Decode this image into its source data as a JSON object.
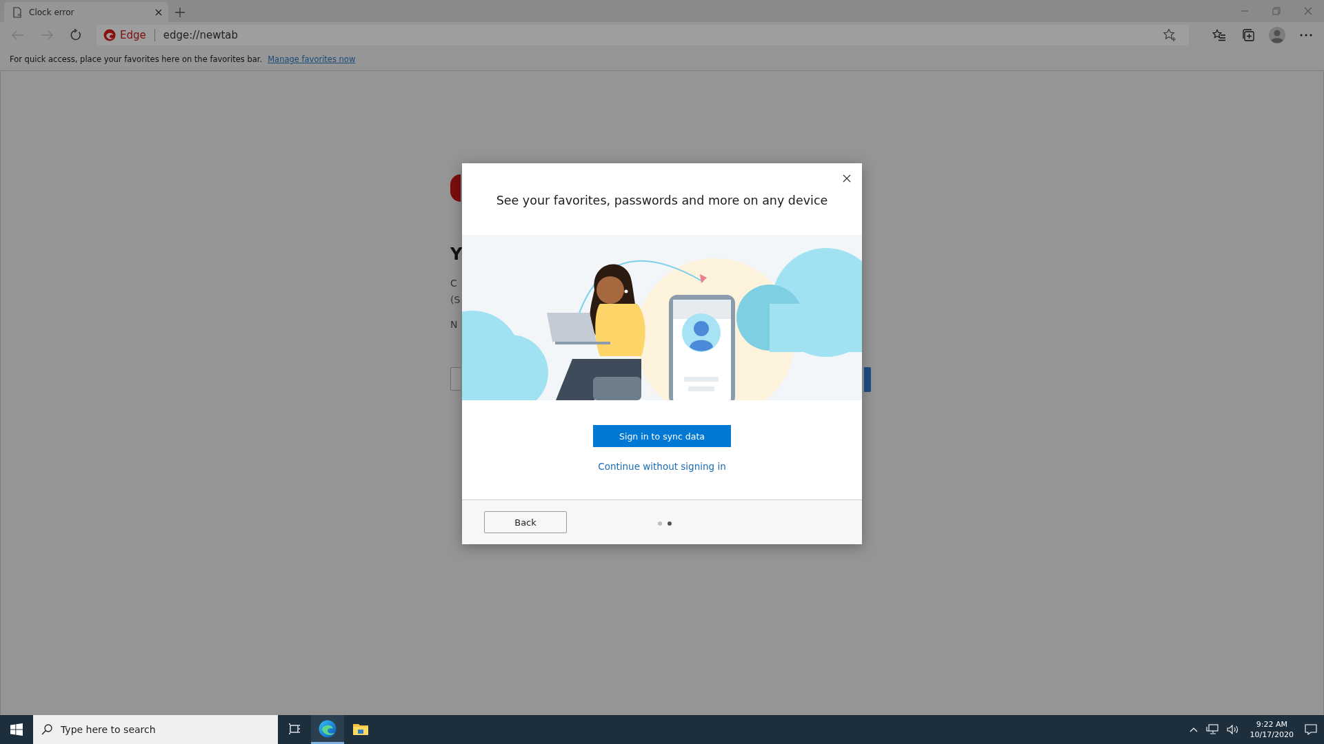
{
  "tabs": [
    {
      "title": "Clock error",
      "selected": true
    }
  ],
  "address_bar": {
    "site_label": "Edge",
    "url": "edge://newtab"
  },
  "favorites_bar": {
    "message": "For quick access, place your favorites here on the favorites bar.",
    "link": "Manage favorites now"
  },
  "background_page": {
    "heading": "Y",
    "lines": [
      "C",
      "(S",
      "N"
    ]
  },
  "dialog": {
    "title": "See your favorites, passwords and more on any device",
    "primary_button": "Sign in to sync data",
    "link": "Continue without signing in",
    "back_button": "Back",
    "pages": [
      {
        "selected": false
      },
      {
        "selected": true
      }
    ]
  },
  "taskbar": {
    "search_placeholder": "Type here to search",
    "apps": [
      {
        "kind": "task-view",
        "active": false
      },
      {
        "kind": "edge",
        "active": true
      },
      {
        "kind": "explorer",
        "active": false
      }
    ],
    "time": "9:22 AM",
    "date": "10/17/2020"
  }
}
